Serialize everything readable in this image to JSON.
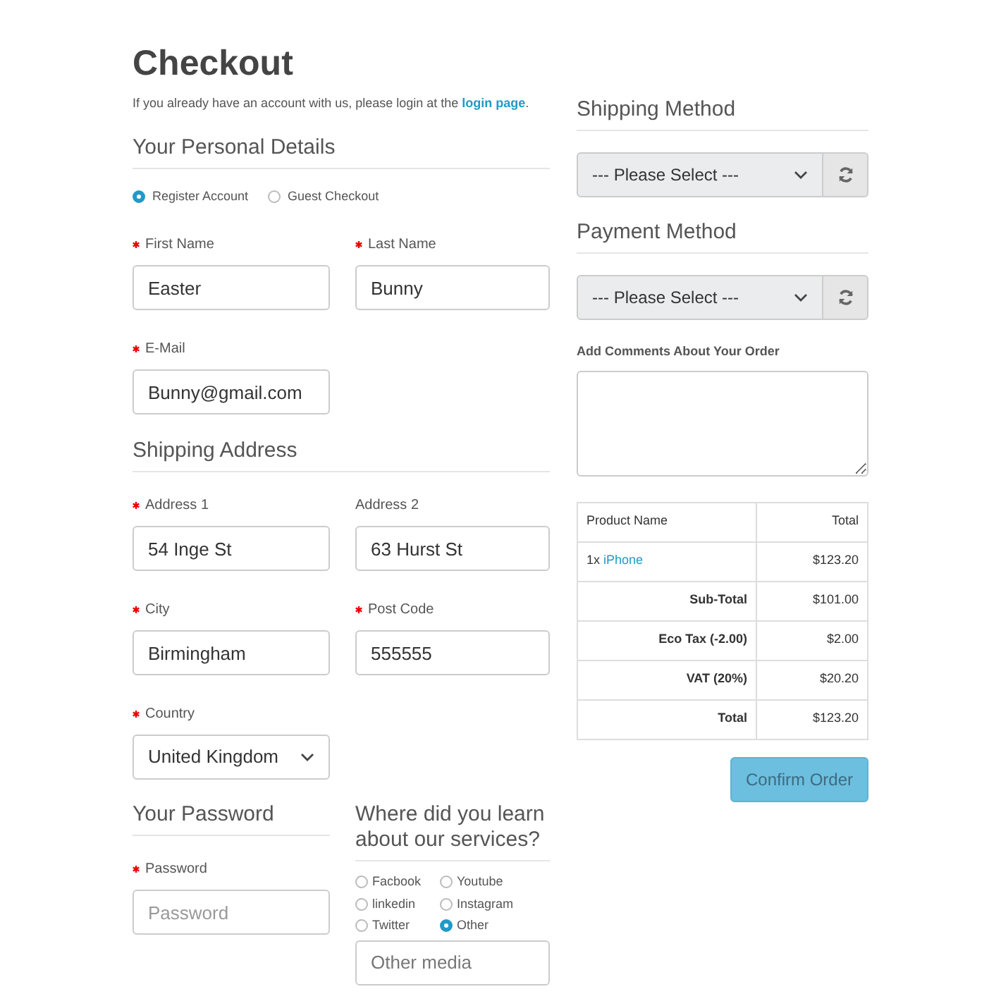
{
  "title": "Checkout",
  "intro": {
    "text": "If you already have an account with us, please login at the ",
    "link": "login page",
    "after": "."
  },
  "personal": {
    "heading": "Your Personal Details",
    "account_options": [
      {
        "label": "Register Account",
        "selected": true
      },
      {
        "label": "Guest Checkout",
        "selected": false
      }
    ],
    "fields": [
      {
        "label": "First Name",
        "required": true,
        "value": "Easter"
      },
      {
        "label": "Last Name",
        "required": true,
        "value": "Bunny"
      },
      {
        "label": "E-Mail",
        "required": true,
        "value": "Bunny@gmail.com"
      }
    ]
  },
  "shipping_address": {
    "heading": "Shipping Address",
    "fields": [
      {
        "label": "Address 1",
        "required": true,
        "value": "54 Inge St",
        "kind": "text"
      },
      {
        "label": "Address 2",
        "required": false,
        "value": "63 Hurst St",
        "kind": "text"
      },
      {
        "label": "City",
        "required": true,
        "value": "Birmingham",
        "kind": "text"
      },
      {
        "label": "Post Code",
        "required": true,
        "value": "555555",
        "kind": "text"
      },
      {
        "label": "Country",
        "required": true,
        "value": "United Kingdom",
        "kind": "select"
      }
    ]
  },
  "password": {
    "heading": "Your Password",
    "label": "Password",
    "required": true,
    "placeholder": "Password"
  },
  "survey": {
    "heading": "Where did you learn about our services?",
    "options": [
      {
        "label": "Facbook",
        "selected": false
      },
      {
        "label": "Youtube",
        "selected": false
      },
      {
        "label": "linkedin",
        "selected": false
      },
      {
        "label": "Instagram",
        "selected": false
      },
      {
        "label": "Twitter",
        "selected": false
      },
      {
        "label": "Other",
        "selected": true
      }
    ],
    "other_placeholder": "Other media"
  },
  "shipping_method": {
    "heading": "Shipping Method",
    "value": "--- Please Select ---"
  },
  "payment_method": {
    "heading": "Payment Method",
    "value": "--- Please Select ---"
  },
  "comments": {
    "label": "Add Comments About Your Order"
  },
  "order_table": {
    "columns": [
      "Product Name",
      "Total"
    ],
    "product": {
      "quantity": "1x",
      "name": "iPhone",
      "total": "$123.20"
    },
    "totals": [
      {
        "label": "Sub-Total",
        "value": "$101.00"
      },
      {
        "label": "Eco Tax (-2.00)",
        "value": "$2.00"
      },
      {
        "label": "VAT (20%)",
        "value": "$20.20"
      },
      {
        "label": "Total",
        "value": "$123.20"
      }
    ]
  },
  "confirm_button": "Confirm Order"
}
